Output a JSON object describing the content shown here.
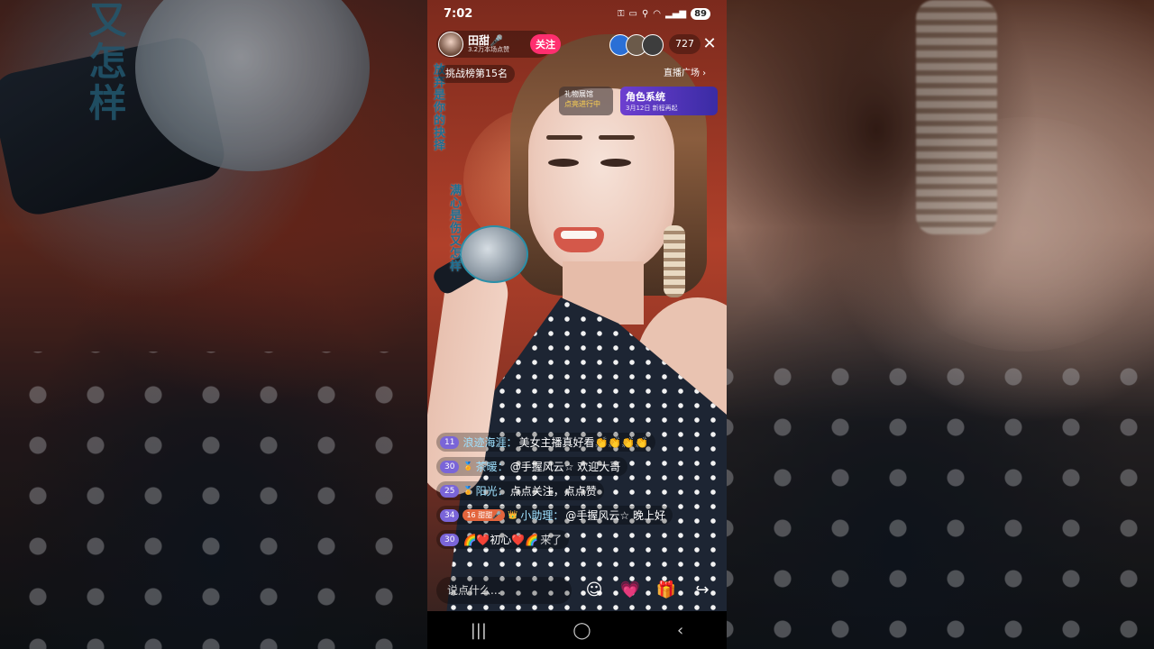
{
  "background": {
    "lyric_text": "又怎样"
  },
  "status_bar": {
    "time": "7:02",
    "battery": "89"
  },
  "host": {
    "name": "田甜🎤",
    "likes": "3.2万本场点赞",
    "follow_label": "关注"
  },
  "audience_count": "727",
  "close_symbol": "✕",
  "rank_label": "挑战榜第15名",
  "plaza_label": "直播广场 ›",
  "gift_card": {
    "title": "礼物展馆",
    "subtitle": "点亮进行中"
  },
  "role_card": {
    "title": "角色系统",
    "subtitle": "3月12日 新程再起"
  },
  "stage_lyrics": {
    "line1": "放弃是你的抉择",
    "line2": "满心是伤又怎样"
  },
  "chat": [
    {
      "level": "11",
      "name": "浪迹海涯：",
      "text": "美女主播真好看👏👏👏👏"
    },
    {
      "level": "30",
      "name": "茶暖：",
      "text": "@手握风云☆ 欢迎大哥"
    },
    {
      "level": "25",
      "name": "阳光：",
      "text": "点点关注，点点赞"
    },
    {
      "level": "34",
      "fan": "16 甜甜🎤",
      "name": "小助理：",
      "text": "@手握风云☆ 晚上好"
    },
    {
      "level": "30",
      "name": "🌈❤️初心❤️🌈",
      "text": " 来了"
    }
  ],
  "input_placeholder": "说点什么...",
  "bottom_icons": {
    "emoji": "☺",
    "heart": "💗",
    "gift": "🎁",
    "share": "↪"
  },
  "nav": {
    "recent": "|||",
    "home": "◯",
    "back": "‹"
  }
}
